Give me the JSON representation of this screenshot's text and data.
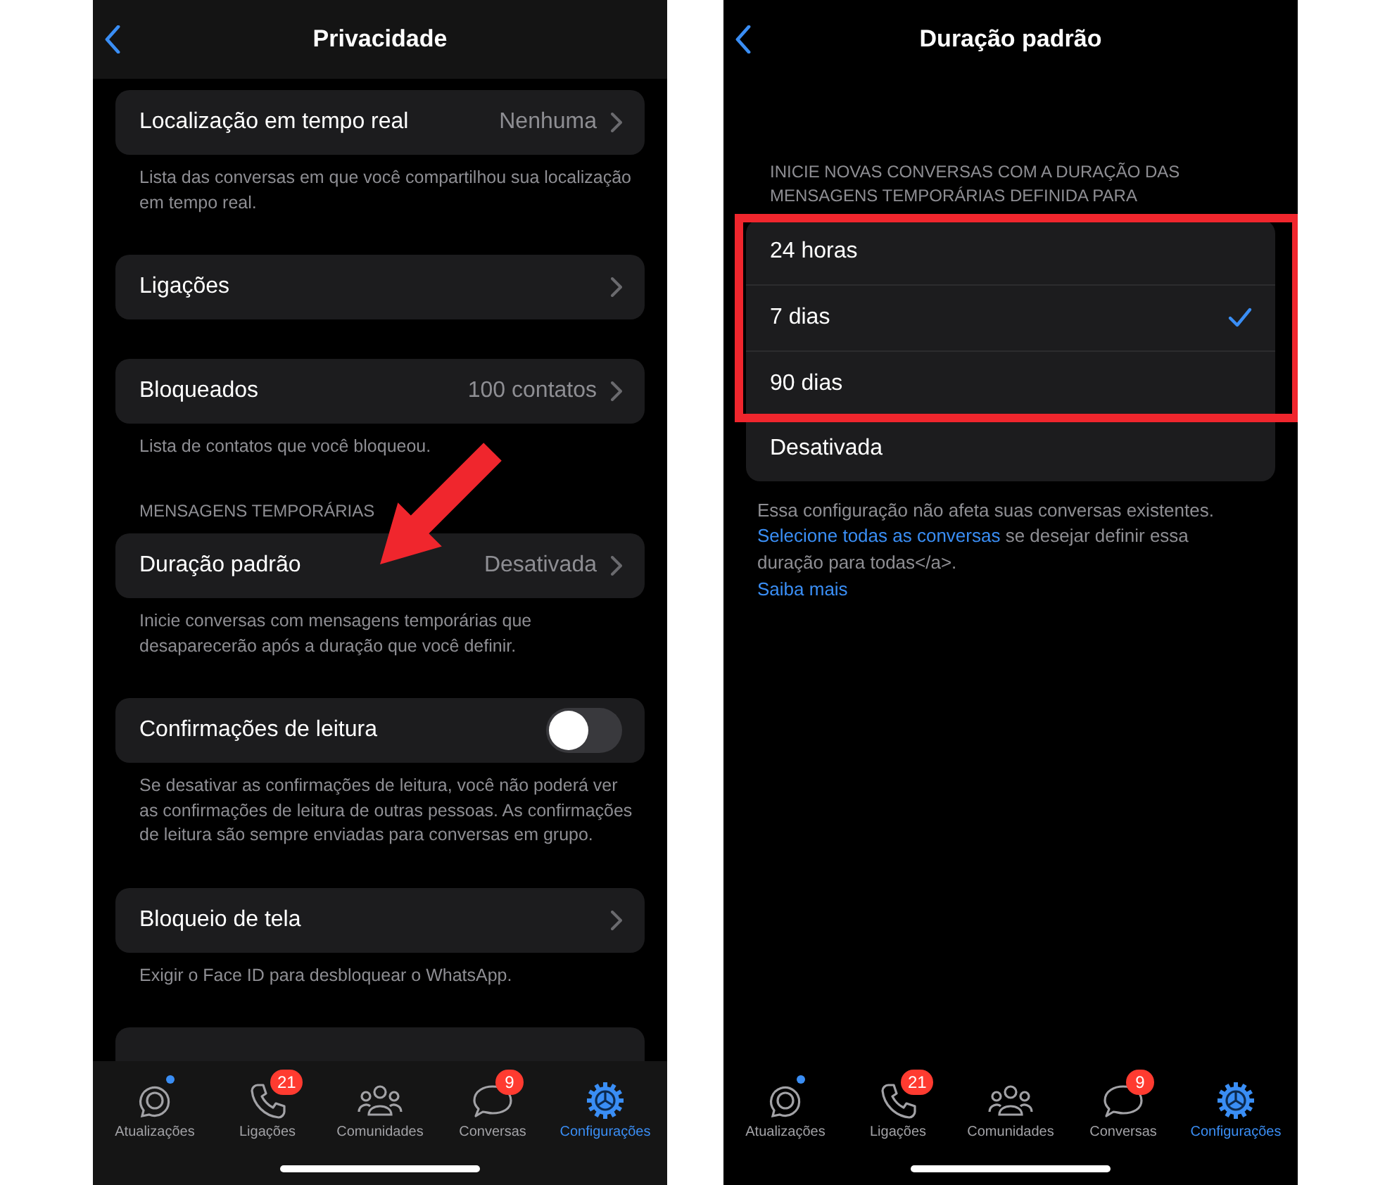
{
  "left_screen": {
    "nav": {
      "title": "Privacidade"
    },
    "sections": [
      {
        "rows": [
          {
            "kind": "link",
            "label": "Localização em tempo real",
            "value": "Nenhuma"
          }
        ],
        "note": "Lista das conversas em que você compartilhou sua localização em tempo real."
      },
      {
        "rows": [
          {
            "kind": "link",
            "label": "Ligações"
          }
        ]
      },
      {
        "rows": [
          {
            "kind": "link",
            "label": "Bloqueados",
            "value": "100 contatos"
          }
        ],
        "note": "Lista de contatos que você bloqueou."
      },
      {
        "header": "MENSAGENS TEMPORÁRIAS",
        "rows": [
          {
            "kind": "link",
            "label": "Duração padrão",
            "value": "Desativada",
            "pointed": true
          }
        ],
        "note": "Inicie conversas com mensagens temporárias que desaparecerão após a duração que você definir."
      },
      {
        "rows": [
          {
            "kind": "toggle",
            "label": "Confirmações de leitura",
            "on": false
          }
        ],
        "note": "Se desativar as confirmações de leitura, você não poderá ver as confirmações de leitura de outras pessoas. As confirmações de leitura são sempre enviadas para conversas em grupo."
      },
      {
        "rows": [
          {
            "kind": "link",
            "label": "Bloqueio de tela"
          }
        ],
        "note": "Exigir o Face ID para desbloquear o WhatsApp."
      },
      {
        "rows": [
          {
            "kind": "blank"
          }
        ]
      }
    ],
    "tabs": [
      {
        "label": "Atualizações",
        "dot": true,
        "selected": false
      },
      {
        "label": "Ligações",
        "badge": "21",
        "dot": false,
        "selected": false
      },
      {
        "label": "Comunidades",
        "dot": false,
        "selected": false
      },
      {
        "label": "Conversas",
        "badge": "9",
        "dot": false,
        "selected": false
      },
      {
        "label": "Configurações",
        "dot": false,
        "selected": true
      }
    ]
  },
  "right_screen": {
    "nav": {
      "title": "Duração padrão"
    },
    "header": "INICIE NOVAS CONVERSAS COM A DURAÇÃO DAS MENSAGENS TEMPORÁRIAS DEFINIDA PARA",
    "options": [
      {
        "label": "24 horas",
        "selected": false,
        "framed": true
      },
      {
        "label": "7 dias",
        "selected": true,
        "framed": true
      },
      {
        "label": "90 dias",
        "selected": false,
        "framed": true
      },
      {
        "label": "Desativada",
        "selected": false,
        "framed": false
      }
    ],
    "footer": {
      "text_before": "Essa configuração não afeta suas conversas existentes.",
      "link": "Selecione todas as conversas",
      "text_after": "se desejar definir essa duração para todas</a>."
    },
    "footer_link": "Saiba mais",
    "tabs": [
      {
        "label": "Atualizações",
        "dot": true,
        "selected": false
      },
      {
        "label": "Ligações",
        "badge": "21",
        "dot": false,
        "selected": false
      },
      {
        "label": "Comunidades",
        "dot": false,
        "selected": false
      },
      {
        "label": "Conversas",
        "badge": "9",
        "dot": false,
        "selected": false
      },
      {
        "label": "Configurações",
        "dot": false,
        "selected": true
      }
    ]
  }
}
